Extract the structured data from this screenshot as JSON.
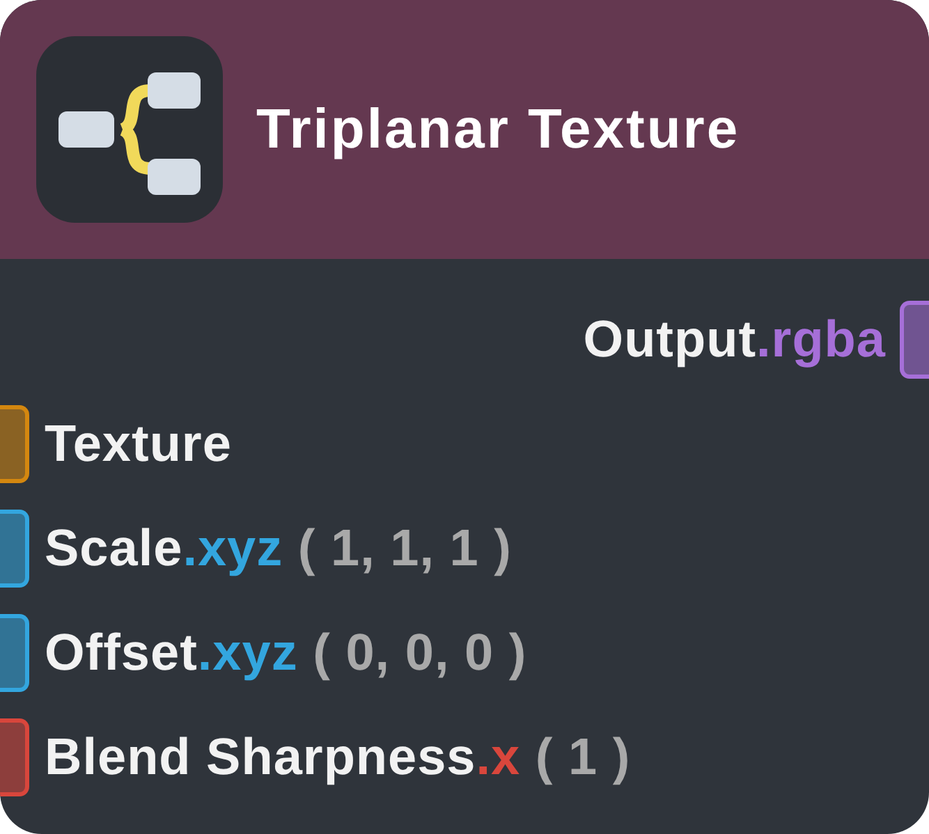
{
  "node": {
    "title": "Triplanar Texture",
    "outputs": [
      {
        "name": "Output",
        "swizzle": ".rgba",
        "color": "#a66fd8"
      }
    ],
    "inputs": [
      {
        "name": "Texture",
        "color": "#d4870f"
      },
      {
        "name": "Scale",
        "swizzle": ".xyz",
        "default": "( 1, 1, 1 )",
        "color": "#33a6df"
      },
      {
        "name": "Offset",
        "swizzle": ".xyz",
        "default": "( 0, 0, 0 )",
        "color": "#33a6df"
      },
      {
        "name": "Blend Sharpness",
        "swizzle": ".x",
        "default": "( 1 )",
        "color": "#d9463c"
      }
    ]
  }
}
